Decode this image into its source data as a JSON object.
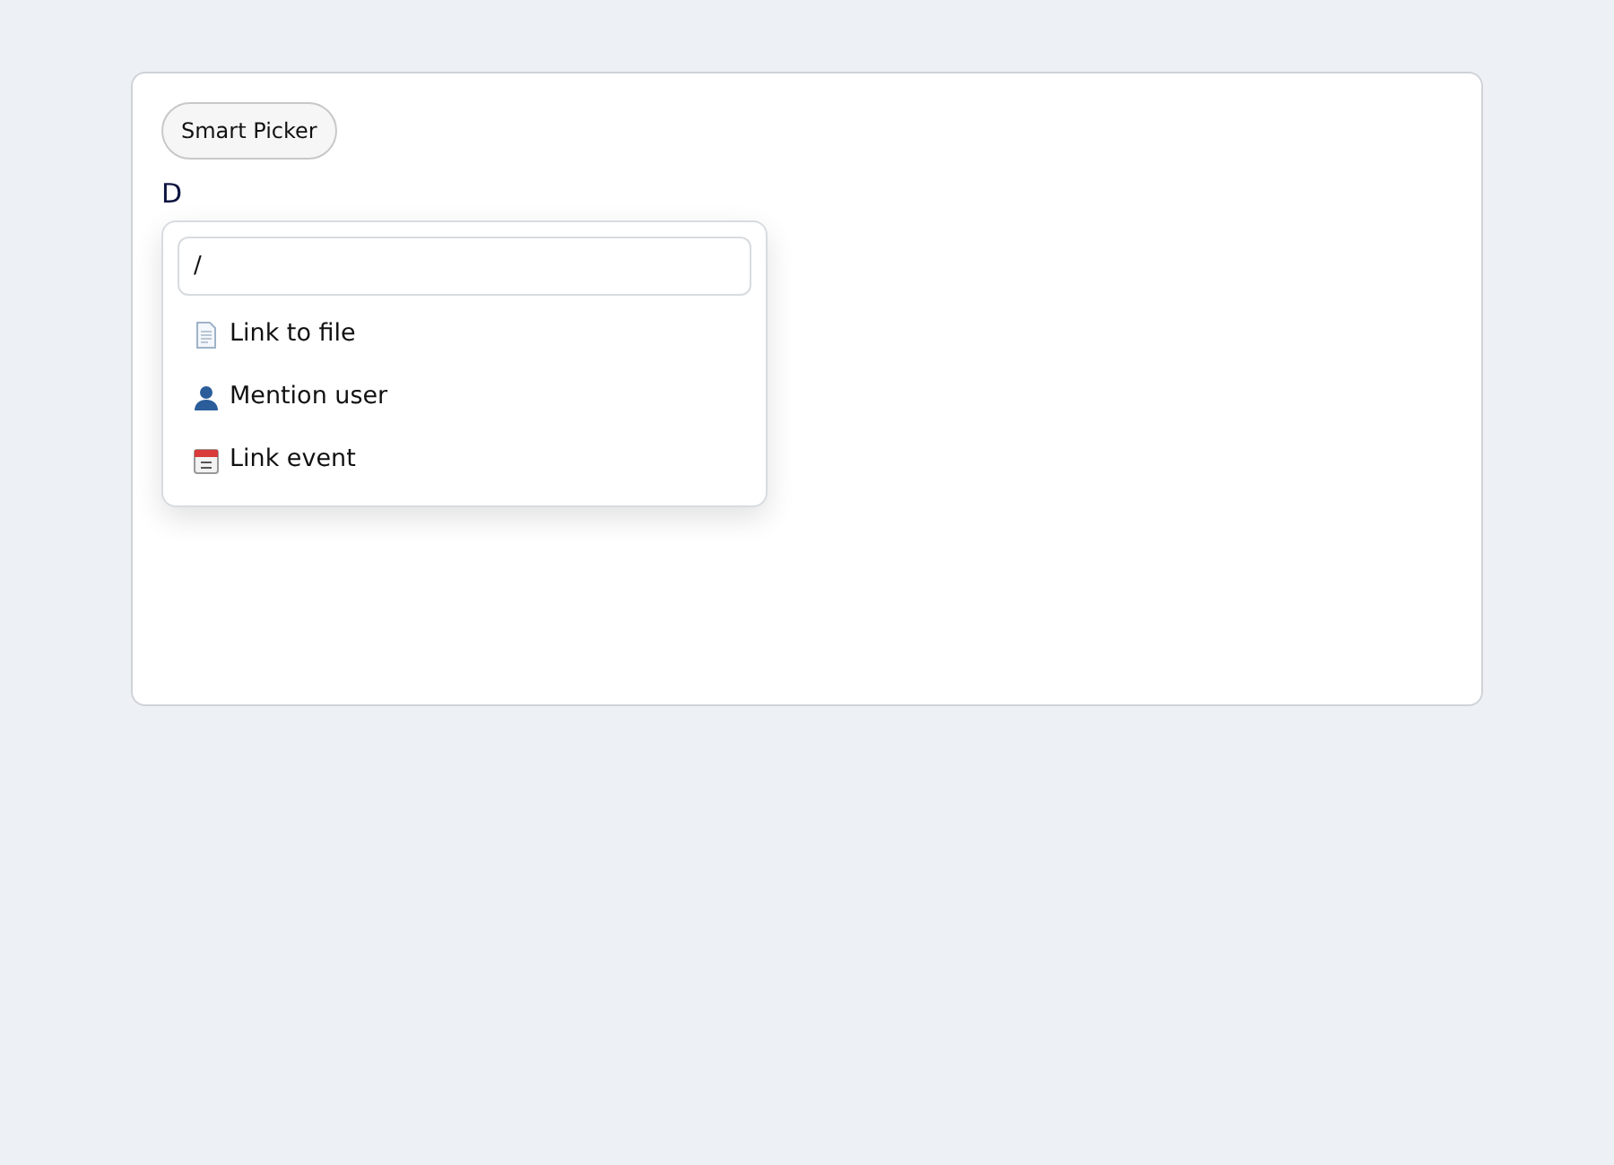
{
  "toolbar": {
    "button": "Smart Picker"
  },
  "editor": {
    "text": "D"
  },
  "picker": {
    "query": "/",
    "items": [
      {
        "kind": "file",
        "label": "Link to file"
      },
      {
        "kind": "user",
        "label": "Mention user"
      },
      {
        "kind": "event",
        "label": "Link event"
      }
    ]
  }
}
